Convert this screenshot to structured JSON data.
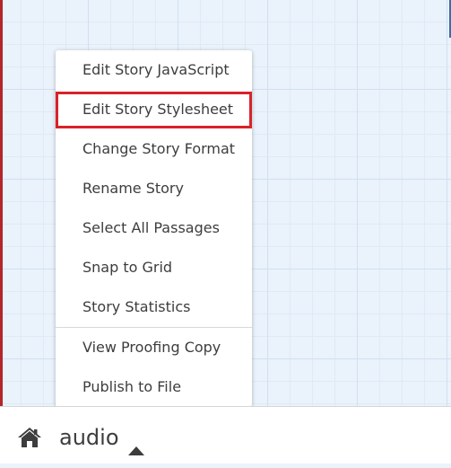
{
  "story_menu": {
    "items": [
      {
        "label": "Edit Story JavaScript"
      },
      {
        "label": "Edit Story Stylesheet"
      },
      {
        "label": "Change Story Format"
      },
      {
        "label": "Rename Story"
      },
      {
        "label": "Select All Passages"
      },
      {
        "label": "Snap to Grid"
      },
      {
        "label": "Story Statistics"
      },
      {
        "label": "View Proofing Copy"
      },
      {
        "label": "Publish to File"
      }
    ],
    "highlighted_item": "Edit Story Stylesheet"
  },
  "toolbar": {
    "home_icon": "home-icon",
    "story_name": "audio",
    "story_menu_icon": "caret-up-icon"
  },
  "colors": {
    "canvas": "#eaf2fb",
    "grid": "#cfe1f3",
    "highlight_border": "#d8222a",
    "text": "#3d3d3d",
    "left_edge": "#b3262c"
  }
}
